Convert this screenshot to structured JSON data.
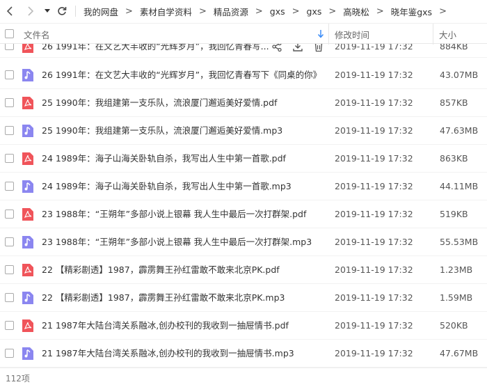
{
  "nav": {
    "breadcrumbs": [
      "我的网盘",
      "素材自学资料",
      "精品资源",
      "gxs",
      "gxs",
      "高晓松",
      "晓年鉴gxs"
    ]
  },
  "header": {
    "name": "文件名",
    "modified": "修改时间",
    "size": "大小"
  },
  "files": [
    {
      "name": "26 1991年：在文艺大丰收的“光辉岁月”，我回忆青春写...",
      "type": "pdf",
      "modified": "2019-11-19 17:32",
      "size": "884KB"
    },
    {
      "name": "26 1991年：在文艺大丰收的“光辉岁月”，我回忆青春写下《同桌的你》",
      "type": "mp3",
      "modified": "2019-11-19 17:32",
      "size": "43.07MB"
    },
    {
      "name": "25 1990年：我组建第一支乐队，流浪厦门邂逅美好爱情.pdf",
      "type": "pdf",
      "modified": "2019-11-19 17:32",
      "size": "857KB"
    },
    {
      "name": "25 1990年：我组建第一支乐队，流浪厦门邂逅美好爱情.mp3",
      "type": "mp3",
      "modified": "2019-11-19 17:32",
      "size": "47.63MB"
    },
    {
      "name": "24 1989年：海子山海关卧轨自杀，我写出人生中第一首歌.pdf",
      "type": "pdf",
      "modified": "2019-11-19 17:32",
      "size": "863KB"
    },
    {
      "name": "24 1989年：海子山海关卧轨自杀，我写出人生中第一首歌.mp3",
      "type": "mp3",
      "modified": "2019-11-19 17:32",
      "size": "44.11MB"
    },
    {
      "name": "23 1988年：“王朔年”多部小说上银幕 我人生中最后一次打群架.pdf",
      "type": "pdf",
      "modified": "2019-11-19 17:32",
      "size": "519KB"
    },
    {
      "name": "23 1988年：“王朔年”多部小说上银幕 我人生中最后一次打群架.mp3",
      "type": "mp3",
      "modified": "2019-11-19 17:32",
      "size": "55.53MB"
    },
    {
      "name": "22 【精彩剧透】1987，霹雳舞王孙红雷敢不敢来北京PK.pdf",
      "type": "pdf",
      "modified": "2019-11-19 17:32",
      "size": "1.23MB"
    },
    {
      "name": "22 【精彩剧透】1987，霹雳舞王孙红雷敢不敢来北京PK.mp3",
      "type": "mp3",
      "modified": "2019-11-19 17:32",
      "size": "1.59MB"
    },
    {
      "name": "21 1987年大陆台湾关系融冰,创办校刊的我收到一抽屉情书.pdf",
      "type": "pdf",
      "modified": "2019-11-19 17:32",
      "size": "520KB"
    },
    {
      "name": "21 1987年大陆台湾关系融冰,创办校刊的我收到一抽屉情书.mp3",
      "type": "mp3",
      "modified": "2019-11-19 17:32",
      "size": "47.67MB"
    }
  ],
  "footer": {
    "count": "112项"
  },
  "colors": {
    "pdf": "#f0545a",
    "mp3": "#8b86f0",
    "sort_arrow": "#3b8cf7"
  },
  "icons": {
    "back": "chevron-left-icon",
    "forward": "chevron-right-icon",
    "dropdown": "caret-down-icon",
    "refresh": "refresh-icon",
    "pdf": "pdf-file-icon",
    "mp3": "audio-file-icon",
    "share": "share-icon",
    "download": "download-icon",
    "delete": "trash-icon"
  }
}
